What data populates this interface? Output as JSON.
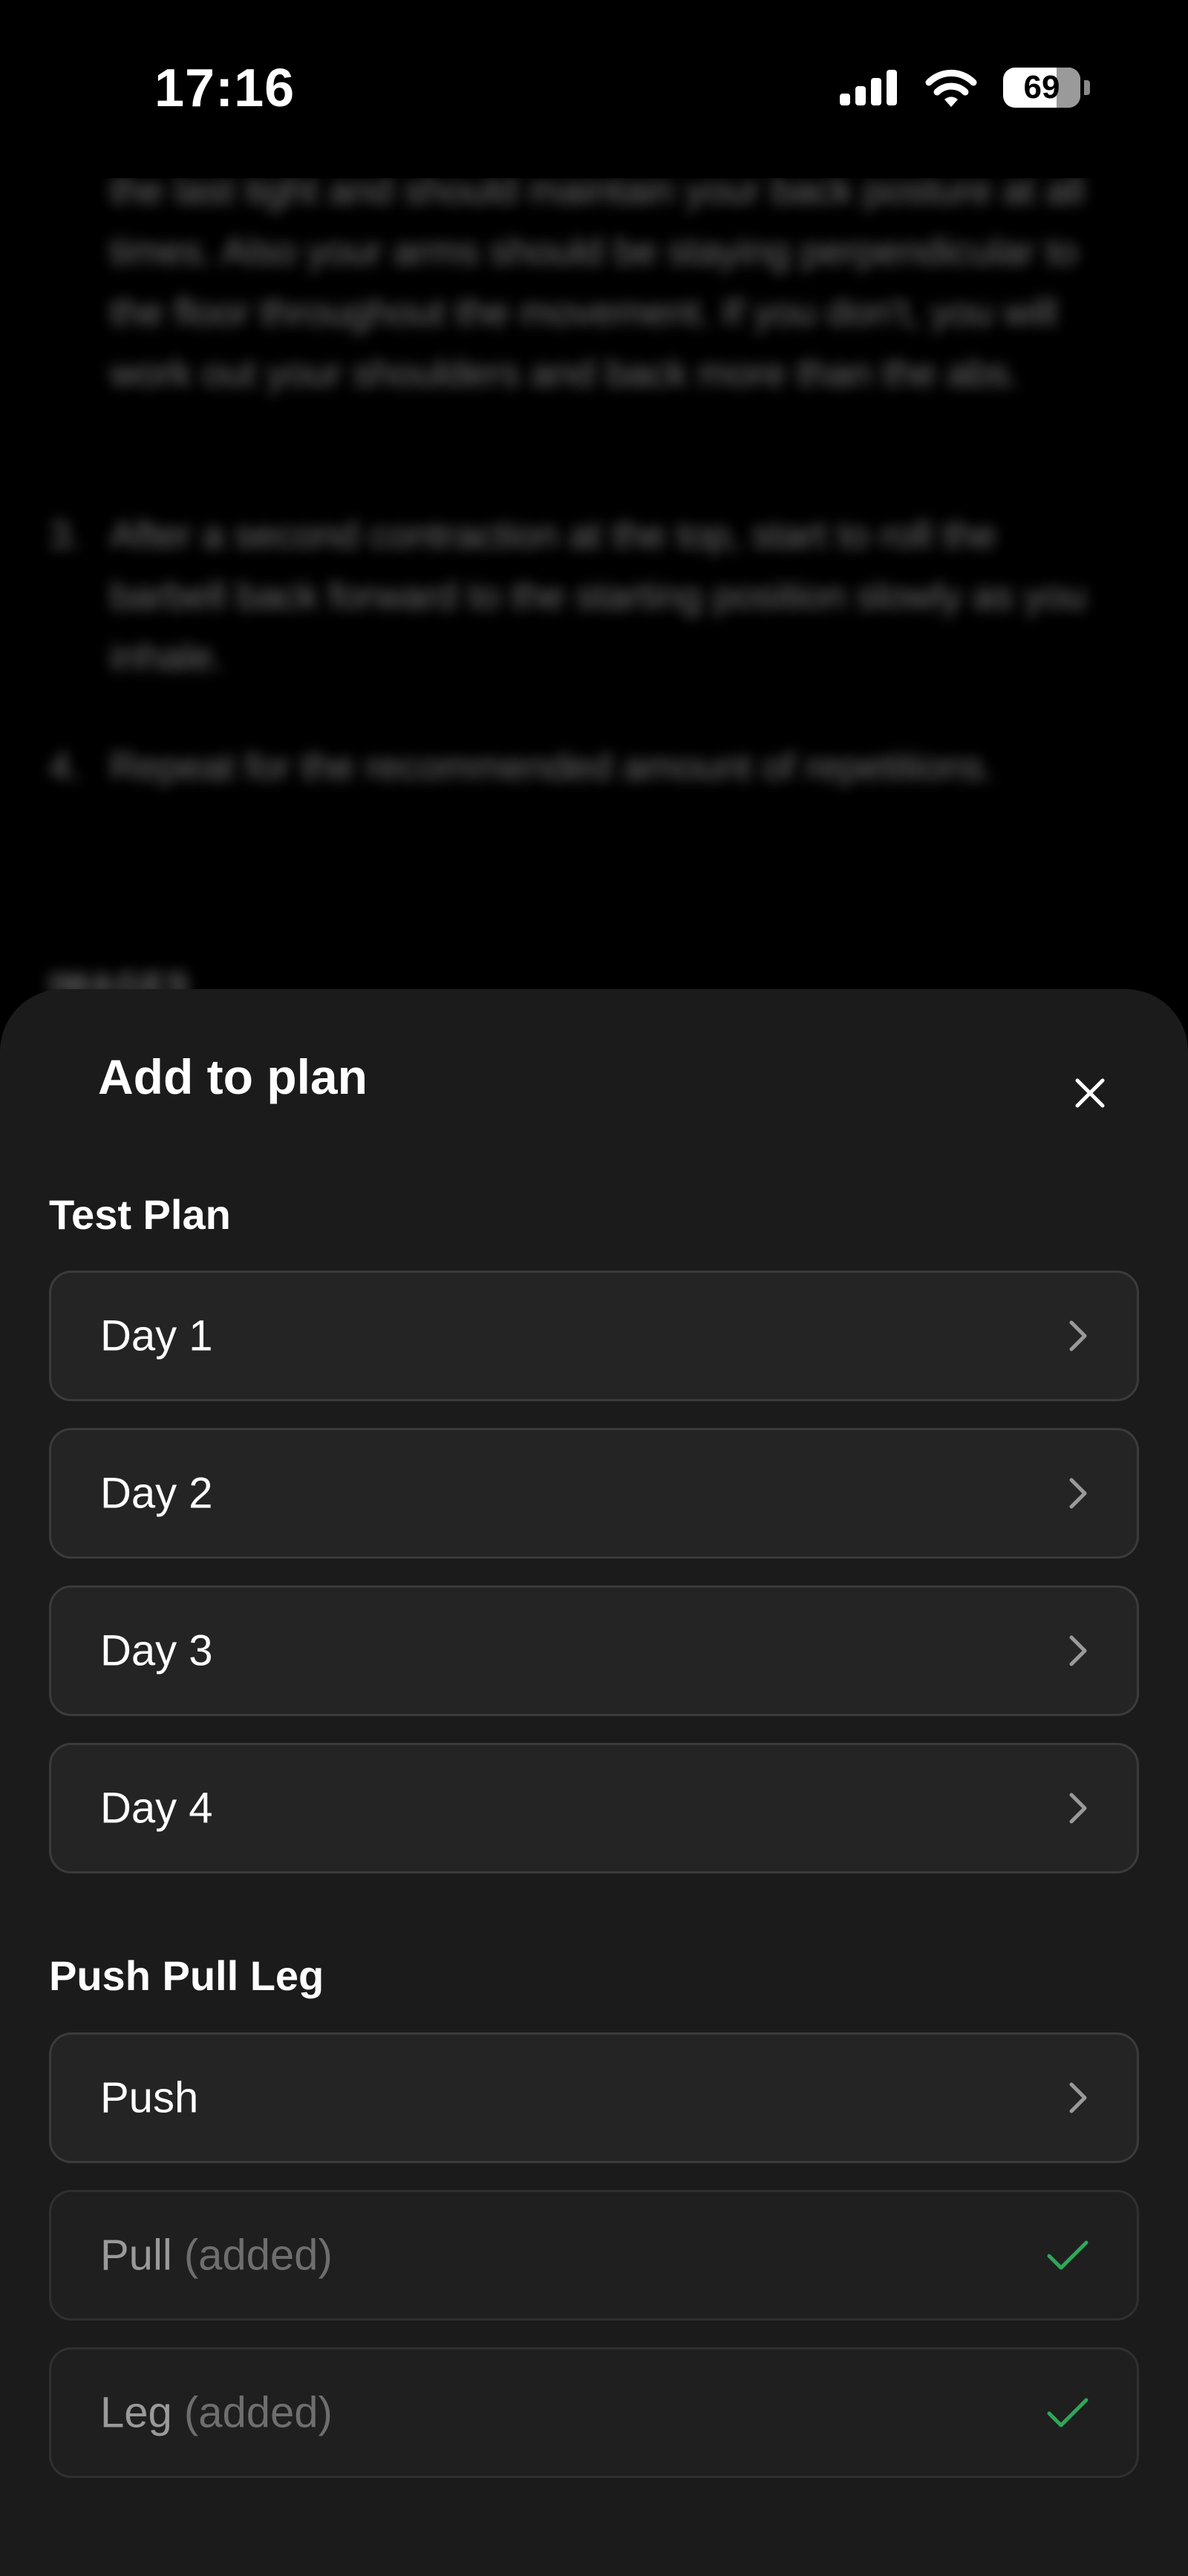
{
  "status_bar": {
    "time": "17:16",
    "battery_percent": "69",
    "battery_level": 0.69
  },
  "background": {
    "paragraph_2_tail": "the last tight and should maintain your back posture at all times. Also your arms should be staying perpendicular to the floor throughout the movement. If you don't, you will work out your shoulders and back more than the abs.",
    "step_3_number": "3.",
    "step_3_text": "After a second contraction at the top, start to roll the barbell back forward to the starting position slowly as you inhale.",
    "step_4_number": "4.",
    "step_4_text": "Repeat for the recommended amount of repetitions.",
    "section_heading": "IMAGES"
  },
  "sheet": {
    "title": "Add to plan",
    "groups": [
      {
        "title": "Test Plan",
        "items": [
          {
            "label": "Day 1",
            "added_note": "",
            "status": "available"
          },
          {
            "label": "Day 2",
            "added_note": "",
            "status": "available"
          },
          {
            "label": "Day 3",
            "added_note": "",
            "status": "available"
          },
          {
            "label": "Day 4",
            "added_note": "",
            "status": "available"
          }
        ]
      },
      {
        "title": "Push Pull Leg",
        "items": [
          {
            "label": "Push",
            "added_note": "",
            "status": "available"
          },
          {
            "label": "Pull",
            "added_note": "(added)",
            "status": "added"
          },
          {
            "label": "Leg",
            "added_note": "(added)",
            "status": "added"
          }
        ]
      }
    ]
  },
  "icons": {
    "close": "close-icon",
    "chevron": "chevron-right-icon",
    "check": "check-icon"
  },
  "colors": {
    "sheet_background": "#1b1b1b",
    "option_background": "#242424",
    "option_border": "#3b3b3b",
    "added_text": "#9a9a9a",
    "check_green": "#2fa75a",
    "chevron_gray": "#9a9a9a"
  }
}
